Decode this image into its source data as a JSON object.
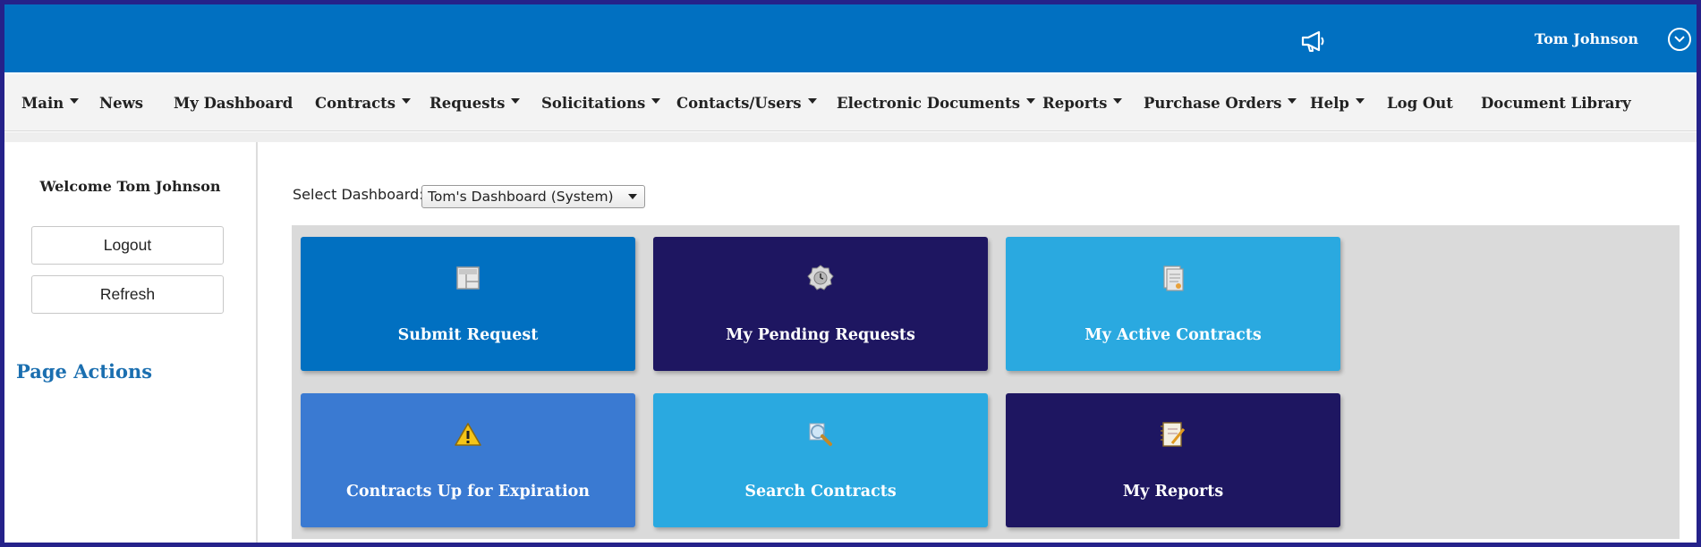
{
  "header": {
    "user_name": "Tom Johnson",
    "announcement_icon": "megaphone-icon",
    "user_menu_icon": "chevron-down-circle-icon",
    "bg_color": "#0170c1"
  },
  "nav": {
    "items": [
      {
        "label": "Main",
        "dropdown": true
      },
      {
        "label": "News",
        "dropdown": false
      },
      {
        "label": "My Dashboard",
        "dropdown": false
      },
      {
        "label": "Contracts",
        "dropdown": true
      },
      {
        "label": "Requests",
        "dropdown": true
      },
      {
        "label": "Solicitations",
        "dropdown": true
      },
      {
        "label": "Contacts/Users",
        "dropdown": true
      },
      {
        "label": "Electronic Documents",
        "dropdown": true
      },
      {
        "label": "Reports",
        "dropdown": true
      },
      {
        "label": "Purchase Orders",
        "dropdown": true
      },
      {
        "label": "Help",
        "dropdown": true
      },
      {
        "label": "Log Out",
        "dropdown": false
      },
      {
        "label": "Document Library",
        "dropdown": false
      }
    ]
  },
  "sidebar": {
    "welcome": "Welcome Tom Johnson",
    "logout_label": "Logout",
    "refresh_label": "Refresh",
    "page_actions": "Page Actions"
  },
  "dashboard": {
    "select_label": "Select Dashboard:",
    "selected_value": "Tom's Dashboard (System)",
    "tiles": [
      {
        "label": "Submit Request",
        "icon": "form-icon",
        "color": "#0170c1"
      },
      {
        "label": "My Pending Requests",
        "icon": "clock-badge-icon",
        "color": "#1e1661"
      },
      {
        "label": "My Active Contracts",
        "icon": "document-icon",
        "color": "#2aa9e0"
      },
      {
        "label": "Contracts Up for Expiration",
        "icon": "warning-icon",
        "color": "#3a7ad2"
      },
      {
        "label": "Search Contracts",
        "icon": "magnifier-icon",
        "color": "#2aa9e0"
      },
      {
        "label": "My Reports",
        "icon": "notebook-icon",
        "color": "#1e1661"
      }
    ]
  }
}
